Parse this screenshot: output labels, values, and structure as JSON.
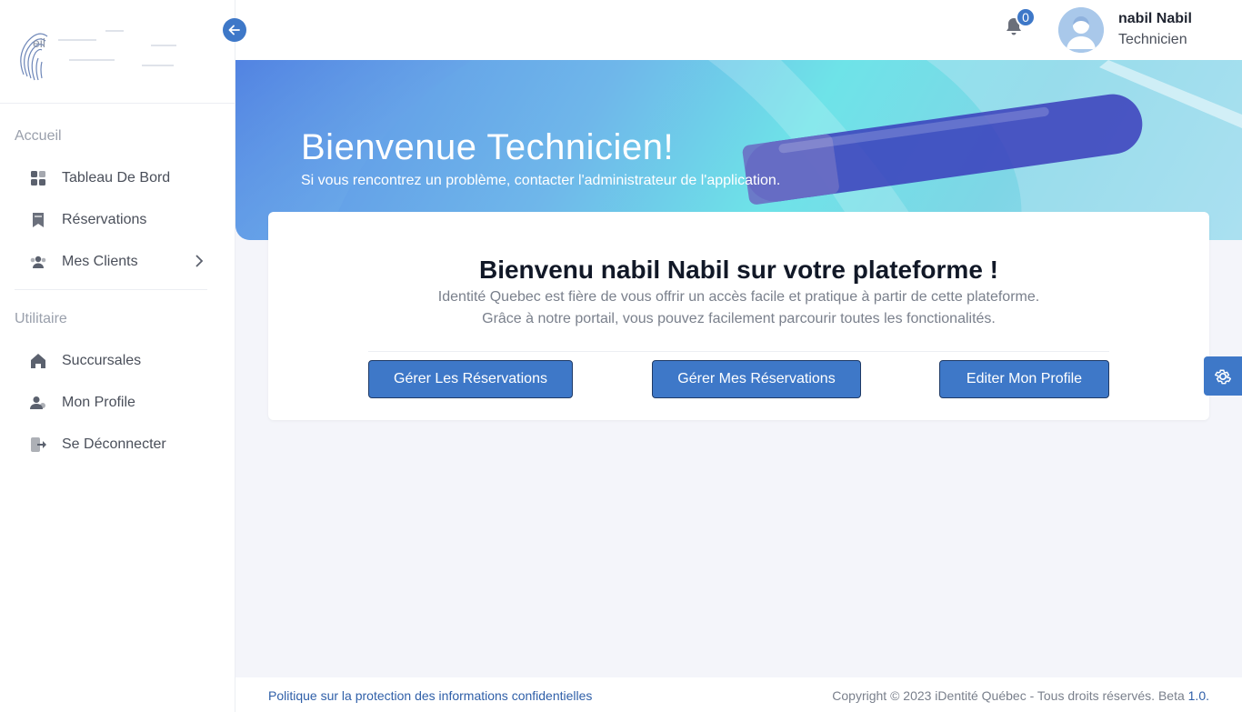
{
  "brand": {
    "logo_text": "eil"
  },
  "sidebar": {
    "sections": [
      {
        "label": "Accueil"
      },
      {
        "label": "Utilitaire"
      }
    ],
    "items": [
      {
        "label": "Tableau De Bord",
        "icon": "grid-icon"
      },
      {
        "label": "Réservations",
        "icon": "bookmark-icon"
      },
      {
        "label": "Mes Clients",
        "icon": "users-icon"
      },
      {
        "label": "Succursales",
        "icon": "home-icon"
      },
      {
        "label": "Mon Profile",
        "icon": "user-icon"
      },
      {
        "label": "Se Déconnecter",
        "icon": "logout-icon"
      }
    ]
  },
  "topbar": {
    "notifications_count": "0",
    "user_name": "nabil Nabil",
    "user_role": "Technicien"
  },
  "banner": {
    "title": "Bienvenue Technicien!",
    "subtitle": "Si vous rencontrez un problème, contacter l'administrateur de l'application."
  },
  "card": {
    "title": "Bienvenu nabil Nabil sur votre plateforme !",
    "line1": "Identité Quebec est fière de vous offrir un accès facile et pratique à partir de cette plateforme.",
    "line2": "Grâce à notre portail, vous pouvez facilement parcourir toutes les fonctionalités.",
    "buttons": [
      {
        "label": "Gérer Les Réservations"
      },
      {
        "label": "Gérer Mes Réservations"
      },
      {
        "label": "Editer Mon Profile"
      }
    ]
  },
  "footer": {
    "privacy_link": "Politique sur la protection des informations confidentielles",
    "copyright": "Copyright © 2023 iDentité Québec - Tous droits réservés. Beta ",
    "version": "1.0."
  },
  "colors": {
    "accent": "#3e78c8",
    "background": "#f4f5fa"
  }
}
